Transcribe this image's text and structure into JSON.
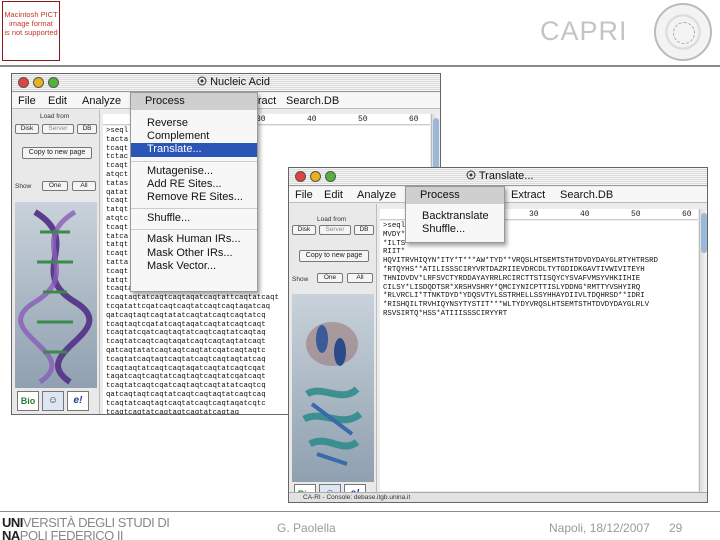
{
  "slide": {
    "placeholder_text": [
      "Macintosh PICT",
      "image format",
      "is not supported"
    ],
    "title": "CAPRI",
    "university_line1_a": "UNI",
    "university_line1_b": "VERSITÀ",
    "university_line1_c": " DEGLI ",
    "university_line1_d": "STUDI",
    "university_line1_e": " DI",
    "university_line2_a": "NA",
    "university_line2_b": "POLI ",
    "university_line2_c": "FEDERICO",
    "university_line2_d": " II",
    "footer_author": "G. Paolella",
    "footer_date": "Napoli, 18/12/2007",
    "page_number": "29"
  },
  "window_back": {
    "title": "Nucleic Acid",
    "menu": [
      "File",
      "Edit",
      "Analyze",
      "Process",
      "Extract",
      "Search.DB"
    ],
    "sidebar": {
      "load_from": "Load from",
      "source_buttons": [
        "Disk",
        "Server",
        "DB"
      ],
      "copy_button": "Copy to new page",
      "show_label": "Show",
      "show_buttons": [
        "One",
        "All"
      ],
      "logos": [
        "Bio",
        "e!"
      ]
    },
    "ruler": [
      "30",
      "40",
      "50",
      "60"
    ],
    "sequence_lines": [
      ">seql",
      "tacta",
      "tcaqt",
      "tctac",
      "tcaqt",
      "atqct",
      "tatas",
      "qatat",
      "tcaqt",
      "tatqt",
      "atqtc",
      "tcaqt",
      "tatca",
      "tatqt",
      "tcaqt",
      "tatta",
      "tcaqt",
      "tatqt",
      "tcaqtattcaqtatcaqtcaqtaqatcaqt",
      "tcaqtaqtatcaqtcaqtaqatcaqtattcaqtatcaqt",
      "tcqatattcqatcaqtcaqtatcaqtcaqtaqatcaq",
      "qatcaqtaqtcaqtatatcaqtatcaqtcaqtatcq",
      "tcaqtaqtcqatatcaqtaqatcaqtatcaqtcaqt",
      "tcaqtatcqatcaqtaqtatcaqtcaqtatcaqtaq",
      "tcaqtatcaqtcaqtaqatcaqtcaqtaqtatcaqt",
      "qatcaqtatatcaqtaqtcaqtatcqatcaqtaqtc",
      "tcaqtatcaqtaqtcaqtatcaqtcaqtaqtatcaq",
      "tcaqtaqtatcaqtcaqtaqatcaqtatcaqtcqat",
      "taqatcaqtcaqtatcaqtaqtcaqtatcqatcaqt",
      "tcaqtatcaqtcqatcaqtaqtcaqtatatcaqtcq",
      "qatcaqtaqtcaqtatcaqtcaqtaqtatcaqtcaq",
      "tcaqtatcaqtaqtcaqtatcaqtcaqtaqatcqtc",
      "tcaqtcaqtatcaqtaqtcaqtatcaqtaq"
    ],
    "status": ""
  },
  "menu_process": {
    "header": "Process",
    "groups": [
      [
        "Reverse",
        "Complement",
        "Translate..."
      ],
      [
        "Mutagenise...",
        "Add RE Sites...",
        "Remove RE Sites..."
      ],
      [
        "Shuffle..."
      ],
      [
        "Mask Human IRs...",
        "Mask Other IRs...",
        "Mask Vector..."
      ]
    ],
    "selected": "Translate..."
  },
  "window_front": {
    "title": "Translate...",
    "menu": [
      "File",
      "Edit",
      "Analyze",
      "Process",
      "Extract",
      "Search.DB"
    ],
    "sidebar": {
      "load_from": "Load from",
      "source_buttons": [
        "Disk",
        "Server",
        "DB"
      ],
      "copy_button": "Copy to new page",
      "show_label": "Show",
      "show_buttons": [
        "One",
        "All"
      ],
      "logos": [
        "Bio",
        "e!"
      ]
    },
    "ruler": [
      "30",
      "40",
      "50",
      "60"
    ],
    "sequence_lines": [
      ">seql",
      "MVDY*",
      "*ILTS",
      "RIIT*",
      "HQVITRVHIQYN*ITY*T***AW*TYD**VRQSLHTSEMTSTHTDVDYDAYGLRTYHTRSRD",
      "*RTQYHS**ATILISSSCIRYVRTDAZRIIEVDRCDLTYTGDIDKGAVTIVWIVITEYH",
      "THNIDVDV*LRFSVCTYRDDAYAYRRLRCIRCTTSTISQYCYSVAFVMSYVHKIIHIE",
      "CILSY*LISDQDTSR*XRSHVSHRY*QMCIYNICPTTISLYDDNG*RMTTYVSHYIRQ",
      "*RLVRCLI*TTNKTDYD*YDQSVTYLSSTRHELLSSYHHAYDIIVLTDQHRSD**IDRI",
      "*RISHQILTRVHIQYNSYTYSTIT***WLTYDYVRQSLHTSEMTSTHTDVDYDAYGLRLV",
      "RSVSIRTQ*HSS*ATIIISSSCIRYYRT"
    ],
    "status": "CA-RI - Console: debase.itgb.unina.it"
  },
  "menu_process_front": {
    "header": "Process",
    "items": [
      "Backtranslate",
      "Shuffle..."
    ]
  }
}
